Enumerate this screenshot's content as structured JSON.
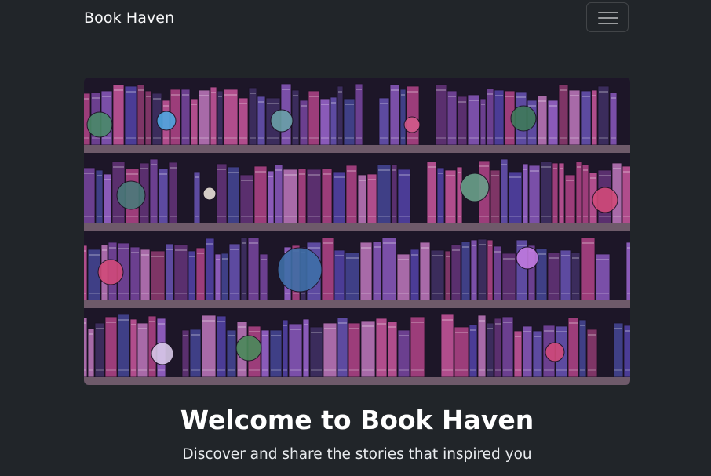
{
  "navbar": {
    "brand": "Book Haven",
    "toggler_icon": "hamburger-menu-icon"
  },
  "hero": {
    "image_subject": "illustrated-bookshelf"
  },
  "main": {
    "title": "Welcome to Book Haven",
    "subtitle": "Discover and share the stories that inspired you"
  },
  "colors": {
    "background": "#212529",
    "text": "#ffffff",
    "book_purple": "#6b3f8f",
    "book_magenta": "#9c3d7a",
    "book_indigo": "#3f3f86",
    "shelf_wood": "#5a4a5e"
  }
}
